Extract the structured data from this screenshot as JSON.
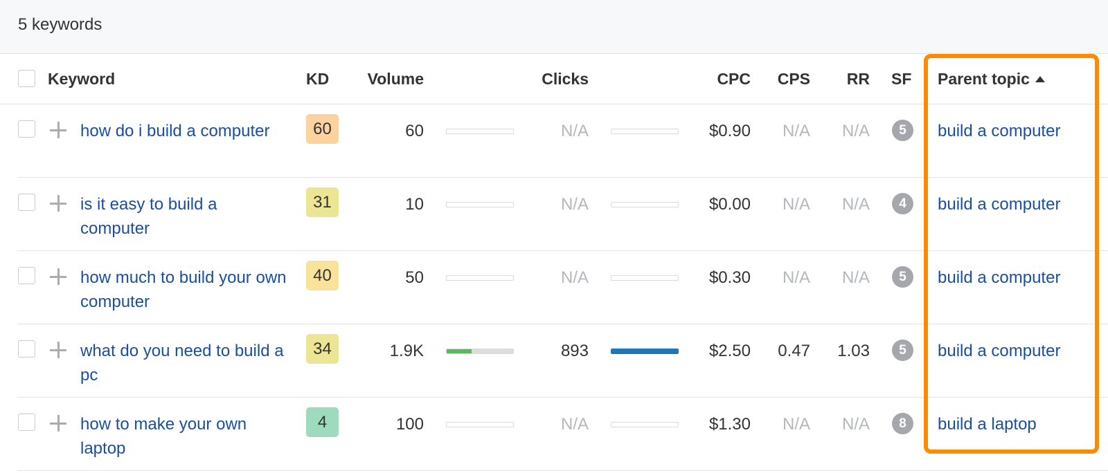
{
  "summary": {
    "count_label": "5 keywords"
  },
  "columns": {
    "keyword": "Keyword",
    "kd": "KD",
    "volume": "Volume",
    "clicks": "Clicks",
    "cpc": "CPC",
    "cps": "CPS",
    "rr": "RR",
    "sf": "SF",
    "parent_topic": "Parent topic"
  },
  "sort": {
    "column": "parent_topic",
    "direction": "ascending",
    "icon": "sort-ascending-icon"
  },
  "colors": {
    "link": "#1a4fa0",
    "highlight_border": "#ff8a00",
    "volume_bar": "#5cb85c",
    "clicks_bar": "#1f77b4"
  },
  "rows": [
    {
      "keyword": "how do i build a computer",
      "kd": "60",
      "kd_color": "#fcd29f",
      "volume": "60",
      "volume_bar_fraction": 0,
      "clicks": "N/A",
      "clicks_bar_fraction": 0,
      "cpc": "$0.90",
      "cps": "N/A",
      "rr": "N/A",
      "sf": "5",
      "parent_topic": "build a computer"
    },
    {
      "keyword": "is it easy to build a computer",
      "kd": "31",
      "kd_color": "#ece593",
      "volume": "10",
      "volume_bar_fraction": 0,
      "clicks": "N/A",
      "clicks_bar_fraction": 0,
      "cpc": "$0.00",
      "cps": "N/A",
      "rr": "N/A",
      "sf": "4",
      "parent_topic": "build a computer"
    },
    {
      "keyword": "how much to build your own computer",
      "kd": "40",
      "kd_color": "#f9e39a",
      "volume": "50",
      "volume_bar_fraction": 0,
      "clicks": "N/A",
      "clicks_bar_fraction": 0,
      "cpc": "$0.30",
      "cps": "N/A",
      "rr": "N/A",
      "sf": "5",
      "parent_topic": "build a computer"
    },
    {
      "keyword": "what do you need to build a pc",
      "kd": "34",
      "kd_color": "#ece593",
      "volume": "1.9K",
      "volume_bar_fraction": 0.38,
      "clicks": "893",
      "clicks_bar_fraction": 1.0,
      "cpc": "$2.50",
      "cps": "0.47",
      "rr": "1.03",
      "sf": "5",
      "parent_topic": "build a computer"
    },
    {
      "keyword": "how to make your own laptop",
      "kd": "4",
      "kd_color": "#9edbbe",
      "volume": "100",
      "volume_bar_fraction": 0,
      "clicks": "N/A",
      "clicks_bar_fraction": 0,
      "cpc": "$1.30",
      "cps": "N/A",
      "rr": "N/A",
      "sf": "8",
      "parent_topic": "build a laptop"
    }
  ]
}
